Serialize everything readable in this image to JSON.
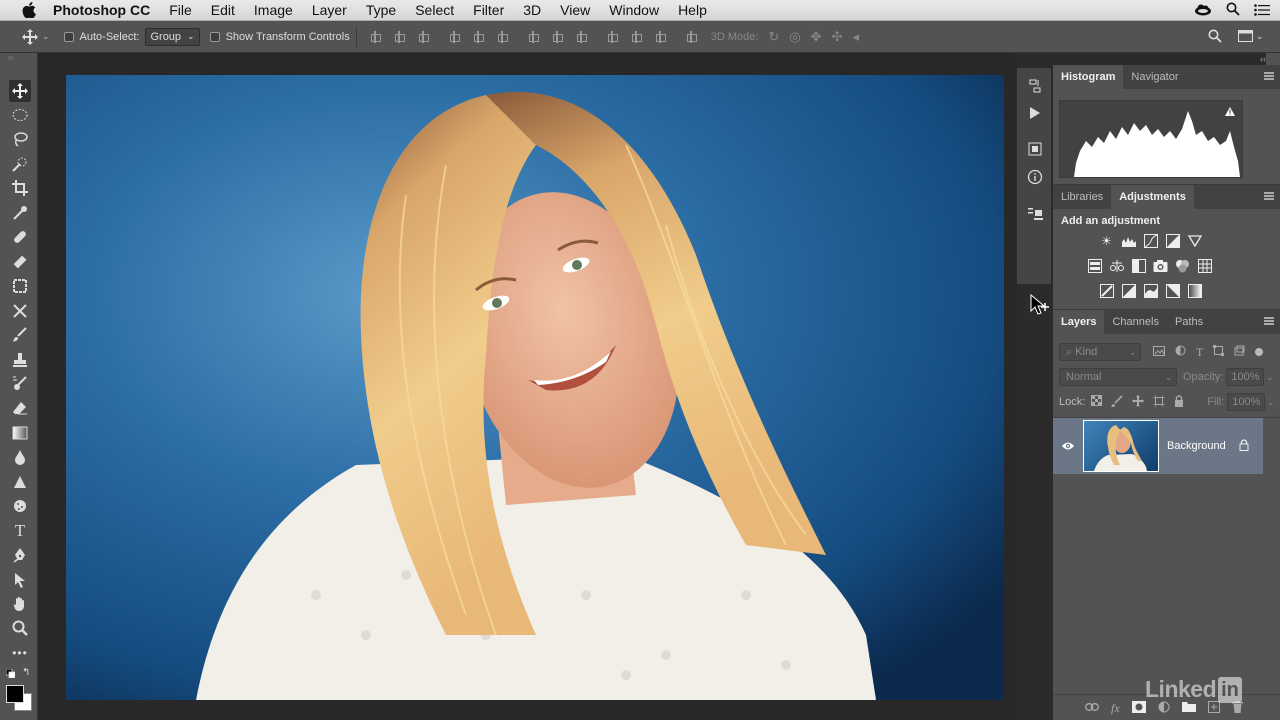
{
  "menubar": {
    "app_name": "Photoshop CC",
    "items": [
      "File",
      "Edit",
      "Image",
      "Layer",
      "Type",
      "Select",
      "Filter",
      "3D",
      "View",
      "Window",
      "Help"
    ]
  },
  "options": {
    "auto_select_label": "Auto-Select:",
    "auto_select_value": "Group",
    "show_transform_label": "Show Transform Controls",
    "mode_3d_label": "3D Mode:"
  },
  "histogram_panel": {
    "tabs": [
      "Histogram",
      "Navigator"
    ]
  },
  "adjustments_panel": {
    "tabs": [
      "Libraries",
      "Adjustments"
    ],
    "heading": "Add an adjustment"
  },
  "layers_panel": {
    "tabs": [
      "Layers",
      "Channels",
      "Paths"
    ],
    "filter_placeholder": "Kind",
    "blend_mode": "Normal",
    "opacity_label": "Opacity:",
    "opacity_value": "100%",
    "lock_label": "Lock:",
    "fill_label": "Fill:",
    "fill_value": "100%",
    "layers": [
      {
        "name": "Background",
        "visible": true,
        "locked": true
      }
    ]
  },
  "watermark": "Linked in",
  "colors": {
    "accent": "#535353",
    "selection": "#6b7686",
    "photo_bg": "#2a6da3"
  }
}
